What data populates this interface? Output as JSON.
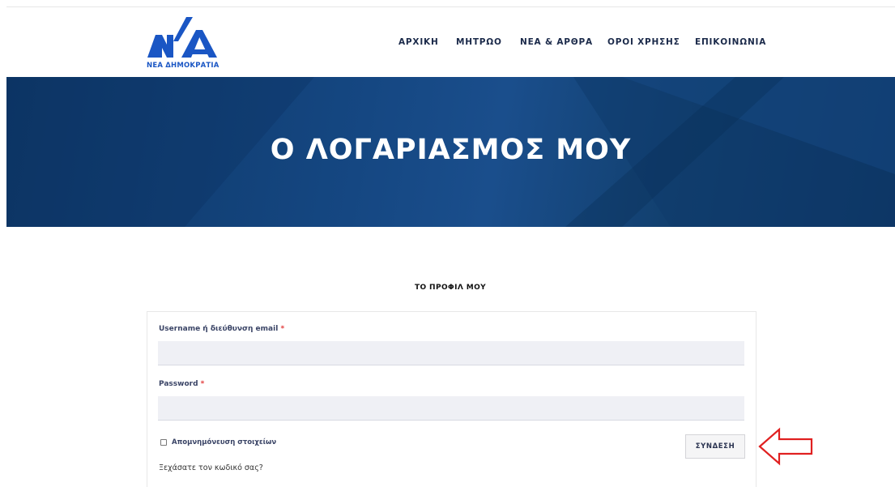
{
  "brand": {
    "logo_text": "ΝΕΑ ΔΗΜΟΚΡΑΤΙΑ",
    "color": "#1a56c4"
  },
  "nav": {
    "items": [
      {
        "label": "ΑΡΧΙΚΗ"
      },
      {
        "label": "ΜΗΤΡΩΟ"
      },
      {
        "label": "ΝΕΑ & ΑΡΘΡΑ"
      },
      {
        "label": "ΟΡΟΙ ΧΡΗΣΗΣ"
      },
      {
        "label": "ΕΠΙΚΟΙΝΩΝΙΑ"
      }
    ]
  },
  "hero": {
    "title": "Ο ΛΟΓΑΡΙΑΣΜΟΣ ΜΟΥ",
    "background_color": "#154782"
  },
  "section": {
    "title": "ΤΟ ΠΡΟΦΙΛ ΜΟΥ"
  },
  "form": {
    "username_label": "Username ή διεύθυνση email",
    "username_value": "",
    "password_label": "Password",
    "password_value": "",
    "required_marker": "*",
    "remember_label": "Απομνημόνευση στοιχείων",
    "remember_checked": false,
    "login_button": "ΣΥΝΔΕΣΗ",
    "forgot_link": "Ξεχάσατε τον κωδικό σας?"
  },
  "annotation": {
    "arrow_color": "#e02020",
    "arrow_direction": "left"
  }
}
